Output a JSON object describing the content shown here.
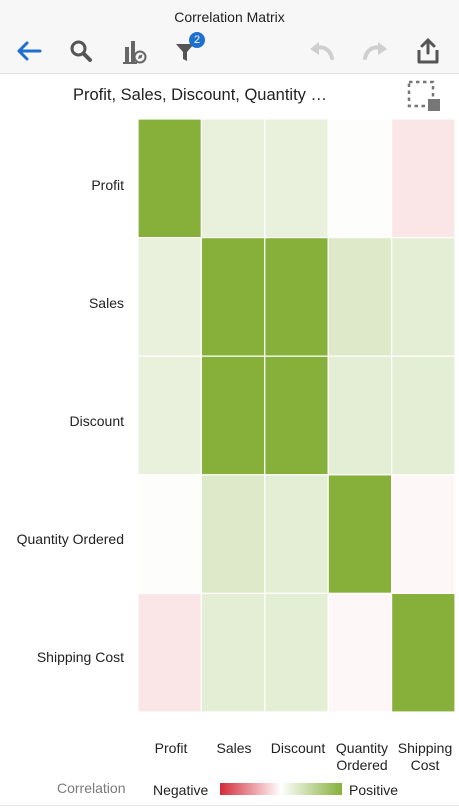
{
  "header": {
    "title": "Correlation Matrix",
    "filter_badge": "2"
  },
  "toolbar": {
    "icons": [
      "back-arrow-icon",
      "search-icon",
      "chart-explore-icon",
      "filter-icon",
      "undo-icon",
      "redo-icon",
      "share-icon"
    ],
    "accent": "#1f6fd0",
    "disabled": "#cfcfcf"
  },
  "subheader": {
    "title": "Profit, Sales, Discount, Quantity …",
    "select_icon": "marquee-select-icon"
  },
  "chart_data": {
    "type": "heatmap",
    "rows": [
      "Profit",
      "Sales",
      "Discount",
      "Quantity Ordered",
      "Shipping Cost"
    ],
    "columns": [
      "Profit",
      "Sales",
      "Discount",
      "Quantity\nOrdered",
      "Shipping\nCost"
    ],
    "values": [
      [
        1.0,
        0.18,
        0.18,
        0.02,
        -0.12
      ],
      [
        0.18,
        1.0,
        1.0,
        0.28,
        0.22
      ],
      [
        0.18,
        1.0,
        1.0,
        0.22,
        0.22
      ],
      [
        0.02,
        0.28,
        0.22,
        1.0,
        -0.04
      ],
      [
        -0.12,
        0.22,
        0.22,
        -0.04,
        1.0
      ]
    ],
    "range": [
      -1,
      1
    ],
    "colors": {
      "negative": "#d42b3b",
      "neutral": "#ffffff",
      "positive": "#86b03a"
    }
  },
  "legend": {
    "title": "Correlation",
    "negative_label": "Negative",
    "positive_label": "Positive"
  }
}
